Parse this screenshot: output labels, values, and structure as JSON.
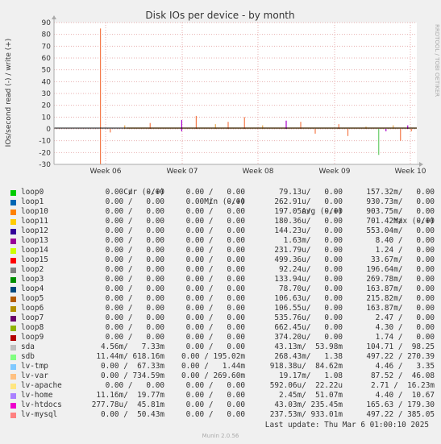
{
  "chart_data": {
    "type": "line",
    "title": "Disk IOs per device - by month",
    "ylabel": "IOs/second read (-) / write (+)",
    "ylim": [
      -30,
      90
    ],
    "yticks": [
      90,
      80,
      70,
      60,
      50,
      40,
      30,
      20,
      10,
      0,
      -10,
      -20,
      -30
    ],
    "xticks": [
      "Week 06",
      "Week 07",
      "Week 08",
      "Week 09",
      "Week 10"
    ],
    "grid": true,
    "spikes": [
      {
        "x": 0.128,
        "y": 85,
        "color": "#f47a4a"
      },
      {
        "x": 0.128,
        "y": -30,
        "color": "#f47a4a"
      },
      {
        "x": 0.155,
        "y": -3,
        "color": "#f47a4a"
      },
      {
        "x": 0.195,
        "y": 3,
        "color": "#e8a84c"
      },
      {
        "x": 0.265,
        "y": 5,
        "color": "#f47a4a"
      },
      {
        "x": 0.352,
        "y": 7.5,
        "color": "#aa00cc"
      },
      {
        "x": 0.352,
        "y": -2,
        "color": "#aa00cc"
      },
      {
        "x": 0.392,
        "y": 11,
        "color": "#f47a4a"
      },
      {
        "x": 0.445,
        "y": 4,
        "color": "#e8a84c"
      },
      {
        "x": 0.48,
        "y": 6,
        "color": "#f47a4a"
      },
      {
        "x": 0.525,
        "y": 10,
        "color": "#f47a4a"
      },
      {
        "x": 0.575,
        "y": 3,
        "color": "#e8a84c"
      },
      {
        "x": 0.64,
        "y": 7,
        "color": "#aa00cc"
      },
      {
        "x": 0.68,
        "y": 6,
        "color": "#f47a4a"
      },
      {
        "x": 0.72,
        "y": -4,
        "color": "#f47a4a"
      },
      {
        "x": 0.785,
        "y": 4,
        "color": "#f47a4a"
      },
      {
        "x": 0.81,
        "y": -6,
        "color": "#f47a4a"
      },
      {
        "x": 0.86,
        "y": 2,
        "color": "#e8a84c"
      },
      {
        "x": 0.895,
        "y": -22,
        "color": "#66cc66"
      },
      {
        "x": 0.915,
        "y": -2,
        "color": "#aa00cc"
      },
      {
        "x": 0.935,
        "y": 3,
        "color": "#e8a84c"
      },
      {
        "x": 0.955,
        "y": -10,
        "color": "#f47a4a"
      },
      {
        "x": 0.975,
        "y": 3,
        "color": "#aa00cc"
      },
      {
        "x": 0.985,
        "y": -2,
        "color": "#f47a4a"
      }
    ]
  },
  "side_label": "RRDTOOL / TOBI OETIKER",
  "legend_headers": {
    "cur": "Cur (-/+)",
    "min": "Min (-/+)",
    "avg": "Avg (-/+)",
    "max": "Max (-/+)"
  },
  "legend": [
    {
      "name": "loop0",
      "color": "#00cc00",
      "cur": "0.00 /   0.00",
      "min": "0.00 /   0.00",
      "avg": "79.13u/   0.00",
      "max": "157.32m/   0.00"
    },
    {
      "name": "loop1",
      "color": "#0066b3",
      "cur": "0.00 /   0.00",
      "min": "0.00 /   0.00",
      "avg": "262.91u/   0.00",
      "max": "930.73m/   0.00"
    },
    {
      "name": "loop10",
      "color": "#ff8000",
      "cur": "0.00 /   0.00",
      "min": "0.00 /   0.00",
      "avg": "197.05u/   0.00",
      "max": "903.75m/   0.00"
    },
    {
      "name": "loop11",
      "color": "#ffcc00",
      "cur": "0.00 /   0.00",
      "min": "0.00 /   0.00",
      "avg": "180.36u/   0.00",
      "max": "701.42m/   0.00"
    },
    {
      "name": "loop12",
      "color": "#330099",
      "cur": "0.00 /   0.00",
      "min": "0.00 /   0.00",
      "avg": "144.23u/   0.00",
      "max": "553.04m/   0.00"
    },
    {
      "name": "loop13",
      "color": "#990099",
      "cur": "0.00 /   0.00",
      "min": "0.00 /   0.00",
      "avg": "1.63m/   0.00",
      "max": "8.40 /   0.00"
    },
    {
      "name": "loop14",
      "color": "#ccff00",
      "cur": "0.00 /   0.00",
      "min": "0.00 /   0.00",
      "avg": "231.79u/   0.00",
      "max": "1.24 /   0.00"
    },
    {
      "name": "loop15",
      "color": "#ff0000",
      "cur": "0.00 /   0.00",
      "min": "0.00 /   0.00",
      "avg": "499.36u/   0.00",
      "max": "33.67m/   0.00"
    },
    {
      "name": "loop2",
      "color": "#808080",
      "cur": "0.00 /   0.00",
      "min": "0.00 /   0.00",
      "avg": "92.24u/   0.00",
      "max": "196.64m/   0.00"
    },
    {
      "name": "loop3",
      "color": "#008f00",
      "cur": "0.00 /   0.00",
      "min": "0.00 /   0.00",
      "avg": "133.94u/   0.00",
      "max": "269.78m/   0.00"
    },
    {
      "name": "loop4",
      "color": "#00487d",
      "cur": "0.00 /   0.00",
      "min": "0.00 /   0.00",
      "avg": "78.70u/   0.00",
      "max": "163.87m/   0.00"
    },
    {
      "name": "loop5",
      "color": "#b35a00",
      "cur": "0.00 /   0.00",
      "min": "0.00 /   0.00",
      "avg": "106.63u/   0.00",
      "max": "215.82m/   0.00"
    },
    {
      "name": "loop6",
      "color": "#b38f00",
      "cur": "0.00 /   0.00",
      "min": "0.00 /   0.00",
      "avg": "106.55u/   0.00",
      "max": "163.87m/   0.00"
    },
    {
      "name": "loop7",
      "color": "#6b006b",
      "cur": "0.00 /   0.00",
      "min": "0.00 /   0.00",
      "avg": "535.76u/   0.00",
      "max": "2.47 /   0.00"
    },
    {
      "name": "loop8",
      "color": "#8fb300",
      "cur": "0.00 /   0.00",
      "min": "0.00 /   0.00",
      "avg": "662.45u/   0.00",
      "max": "4.30 /   0.00"
    },
    {
      "name": "loop9",
      "color": "#b30000",
      "cur": "0.00 /   0.00",
      "min": "0.00 /   0.00",
      "avg": "374.20u/   0.00",
      "max": "1.74 /   0.00"
    },
    {
      "name": "sda",
      "color": "#bebebe",
      "cur": "4.56m/   7.33m",
      "min": "0.00 /   0.00",
      "avg": "43.13m/  53.98m",
      "max": "104.71 /  98.25"
    },
    {
      "name": "sdb",
      "color": "#80ff80",
      "cur": "11.44m/ 618.16m",
      "min": "0.00 / 195.02m",
      "avg": "268.43m/   1.38",
      "max": "497.22 / 270.39"
    },
    {
      "name": "lv-tmp",
      "color": "#80c9ff",
      "cur": "0.00 /  67.33m",
      "min": "0.00 /   1.44m",
      "avg": "918.38u/  84.62m",
      "max": "4.46 /   3.35"
    },
    {
      "name": "lv-var",
      "color": "#ffc080",
      "cur": "0.00 / 734.59m",
      "min": "0.00 / 269.60m",
      "avg": "19.17m/   1.08",
      "max": "87.52 /  46.08"
    },
    {
      "name": "lv-apache",
      "color": "#ffe680",
      "cur": "0.00 /   0.00",
      "min": "0.00 /   0.00",
      "avg": "592.06u/  22.22u",
      "max": "2.71 /  16.23m"
    },
    {
      "name": "lv-home",
      "color": "#aa80ff",
      "cur": "11.16m/  19.77m",
      "min": "0.00 /   0.00",
      "avg": "2.45m/  51.07m",
      "max": "4.40 /  10.67"
    },
    {
      "name": "lv-htdocs",
      "color": "#ee00cc",
      "cur": "277.78u/  45.81m",
      "min": "0.00 /   0.00",
      "avg": "43.03m/ 235.45m",
      "max": "165.63 / 179.30"
    },
    {
      "name": "lv-mysql",
      "color": "#ff8080",
      "cur": "0.00 /  50.43m",
      "min": "0.00 /   0.00",
      "avg": "237.53m/ 933.01m",
      "max": "497.22 / 385.05"
    }
  ],
  "last_update": "Last update: Thu Mar  6 01:00:10 2025",
  "footer": "Munin 2.0.56"
}
